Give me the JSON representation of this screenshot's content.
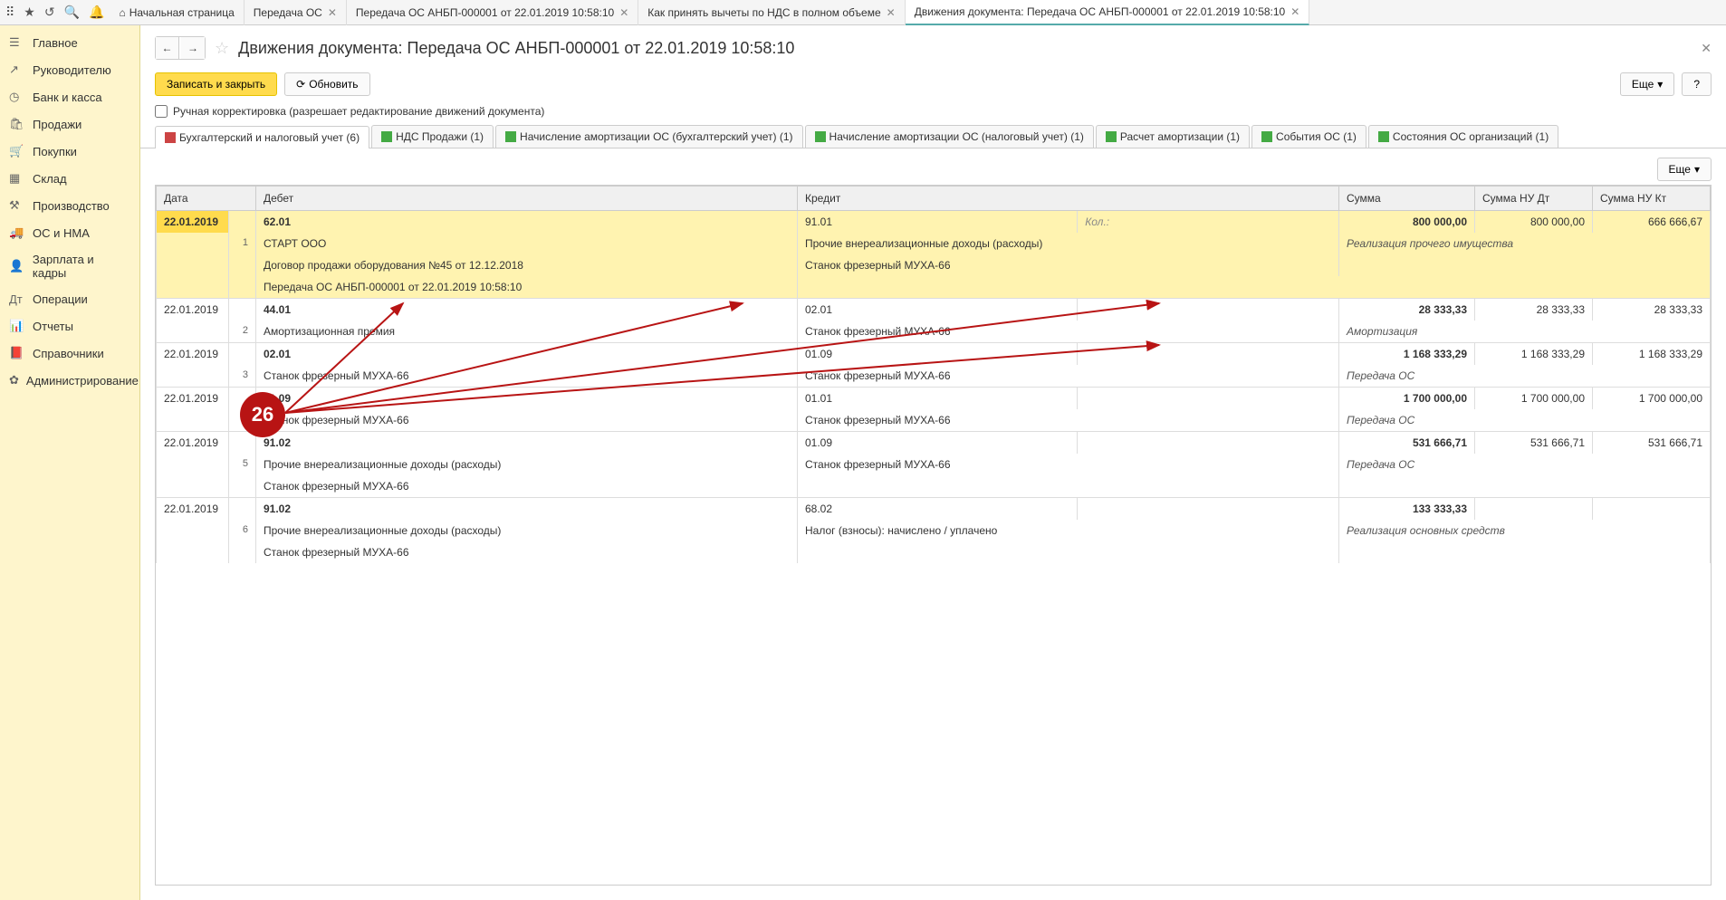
{
  "topTabs": [
    {
      "label": "Начальная страница",
      "home": true,
      "close": false
    },
    {
      "label": "Передача ОС",
      "close": true
    },
    {
      "label": "Передача ОС АНБП-000001 от 22.01.2019 10:58:10",
      "close": true
    },
    {
      "label": "Как принять вычеты по НДС в полном объеме",
      "close": true
    },
    {
      "label": "Движения документа: Передача ОС АНБП-000001 от 22.01.2019 10:58:10",
      "close": true,
      "active": true
    }
  ],
  "sidebar": [
    {
      "icon": "☰",
      "label": "Главное"
    },
    {
      "icon": "↗",
      "label": "Руководителю"
    },
    {
      "icon": "◷",
      "label": "Банк и касса"
    },
    {
      "icon": "🛍",
      "label": "Продажи"
    },
    {
      "icon": "🛒",
      "label": "Покупки"
    },
    {
      "icon": "▦",
      "label": "Склад"
    },
    {
      "icon": "⚒",
      "label": "Производство"
    },
    {
      "icon": "🚚",
      "label": "ОС и НМА"
    },
    {
      "icon": "👤",
      "label": "Зарплата и кадры"
    },
    {
      "icon": "Дт",
      "label": "Операции"
    },
    {
      "icon": "📊",
      "label": "Отчеты"
    },
    {
      "icon": "📕",
      "label": "Справочники"
    },
    {
      "icon": "✿",
      "label": "Администрирование"
    }
  ],
  "pageTitle": "Движения документа: Передача ОС АНБП-000001 от 22.01.2019 10:58:10",
  "btnSave": "Записать и закрыть",
  "btnRefresh": "Обновить",
  "btnMore": "Еще",
  "chkLabel": "Ручная корректировка (разрешает редактирование движений документа)",
  "subtabs": [
    {
      "label": "Бухгалтерский и налоговый учет (6)",
      "color": "red",
      "active": true
    },
    {
      "label": "НДС Продажи (1)",
      "color": "green"
    },
    {
      "label": "Начисление амортизации ОС (бухгалтерский учет) (1)",
      "color": "green"
    },
    {
      "label": "Начисление амортизации ОС (налоговый учет) (1)",
      "color": "green"
    },
    {
      "label": "Расчет амортизации (1)",
      "color": "green"
    },
    {
      "label": "События ОС (1)",
      "color": "green"
    },
    {
      "label": "Состояния ОС организаций (1)",
      "color": "green"
    }
  ],
  "headers": {
    "date": "Дата",
    "debit": "Дебет",
    "credit": "Кредит",
    "sum": "Сумма",
    "sumDt": "Сумма НУ Дт",
    "sumKt": "Сумма НУ Кт"
  },
  "kolLabel": "Кол.:",
  "rows": [
    {
      "n": "1",
      "date": "22.01.2019",
      "hl": true,
      "dAcc": "62.01",
      "cAcc": "91.01",
      "d1": "СТАРТ ООО",
      "c1": "Прочие внереализационные доходы (расходы)",
      "d2": "Договор продажи оборудования №45 от 12.12.2018",
      "c2": "Станок фрезерный МУХА-66",
      "d3": "Передача ОС АНБП-000001 от 22.01.2019 10:58:10",
      "sum": "800 000,00",
      "sumDt": "800 000,00",
      "sumKt": "666 666,67",
      "note": "Реализация прочего имущества"
    },
    {
      "n": "2",
      "date": "22.01.2019",
      "dAcc": "44.01",
      "cAcc": "02.01",
      "d1": "Амортизационная премия",
      "c1": "Станок фрезерный МУХА-66",
      "sum": "28 333,33",
      "sumDt": "28 333,33",
      "sumKt": "28 333,33",
      "note": "Амортизация"
    },
    {
      "n": "3",
      "date": "22.01.2019",
      "dAcc": "02.01",
      "cAcc": "01.09",
      "d1": "Станок фрезерный МУХА-66",
      "c1": "Станок фрезерный МУХА-66",
      "sum": "1 168 333,29",
      "sumDt": "1 168 333,29",
      "sumKt": "1 168 333,29",
      "note": "Передача ОС"
    },
    {
      "n": "4",
      "date": "22.01.2019",
      "dAcc": "01.09",
      "cAcc": "01.01",
      "d1": "Станок фрезерный МУХА-66",
      "c1": "Станок фрезерный МУХА-66",
      "sum": "1 700 000,00",
      "sumDt": "1 700 000,00",
      "sumKt": "1 700 000,00",
      "note": "Передача ОС"
    },
    {
      "n": "5",
      "date": "22.01.2019",
      "dAcc": "91.02",
      "cAcc": "01.09",
      "d1": "Прочие внереализационные доходы (расходы)",
      "c1": "Станок фрезерный МУХА-66",
      "d2": "Станок фрезерный МУХА-66",
      "sum": "531 666,71",
      "sumDt": "531 666,71",
      "sumKt": "531 666,71",
      "note": "Передача ОС"
    },
    {
      "n": "6",
      "date": "22.01.2019",
      "dAcc": "91.02",
      "cAcc": "68.02",
      "d1": "Прочие внереализационные доходы (расходы)",
      "c1": "Налог (взносы): начислено / уплачено",
      "d2": "Станок фрезерный МУХА-66",
      "sum": "133 333,33",
      "note": "Реализация основных средств"
    }
  ],
  "badge": "26"
}
